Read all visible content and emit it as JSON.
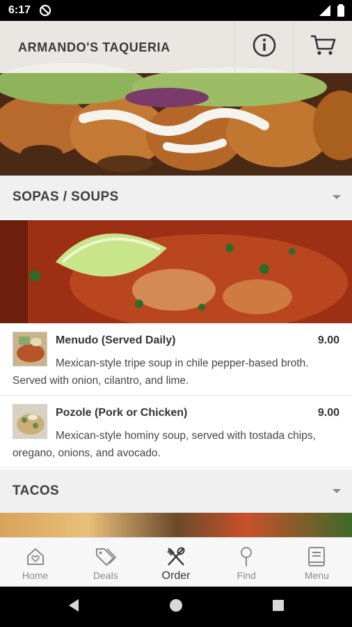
{
  "status_bar": {
    "time": "6:17"
  },
  "header": {
    "title": "ARMANDO'S TAQUERIA"
  },
  "sections": [
    {
      "title": "SOPAS / SOUPS",
      "items": [
        {
          "name": "Menudo (Served Daily)",
          "price": "9.00",
          "description": "Mexican-style tripe soup in chile pepper-based broth. Served with onion, cilantro, and lime."
        },
        {
          "name": "Pozole (Pork or Chicken)",
          "price": "9.00",
          "description": "Mexican-style hominy soup, served with tostada chips, oregano, onions, and avocado."
        }
      ]
    },
    {
      "title": "TACOS"
    }
  ],
  "bottom_nav": {
    "items": [
      {
        "label": "Home",
        "icon": "home-heart-icon"
      },
      {
        "label": "Deals",
        "icon": "tags-icon"
      },
      {
        "label": "Order",
        "icon": "utensils-icon",
        "active": true
      },
      {
        "label": "Find",
        "icon": "map-pin-icon"
      },
      {
        "label": "Menu",
        "icon": "book-icon"
      }
    ]
  },
  "colors": {
    "header_bg": "#f6f4f2",
    "section_bg": "#f0f0f0",
    "nav_bg": "#f7f7f7",
    "text": "#333333"
  }
}
